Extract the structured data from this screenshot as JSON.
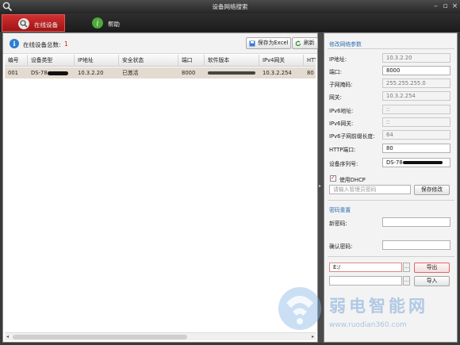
{
  "window": {
    "title": "设备网络搜索"
  },
  "tabs": [
    {
      "label": "在线设备",
      "active": true
    },
    {
      "label": "帮助",
      "active": false
    }
  ],
  "toolbar": {
    "count_label": "在线设备总数:",
    "count_value": "1",
    "save_excel_label": "保存为Excel",
    "refresh_label": "刷新"
  },
  "table": {
    "columns": [
      "编号",
      "设备类型",
      "IP地址",
      "安全状态",
      "端口",
      "软件版本",
      "IPv4网关",
      "HTT"
    ],
    "rows": [
      {
        "no": "001",
        "type": "DS-78",
        "ip": "10.3.2.20",
        "status": "已激活",
        "port": "8000",
        "version": "",
        "gateway": "10.3.2.254",
        "http": "80"
      }
    ]
  },
  "right_panel": {
    "modify_title": "修改网络参数",
    "fields": [
      {
        "label": "IP地址:",
        "value": "10.3.2.20",
        "editable": false
      },
      {
        "label": "端口:",
        "value": "8000",
        "editable": true
      },
      {
        "label": "子网掩码:",
        "value": "255.255.255.0",
        "editable": false
      },
      {
        "label": "网关:",
        "value": "10.3.2.254",
        "editable": false
      },
      {
        "label": "IPv6地址:",
        "value": "::",
        "editable": false
      },
      {
        "label": "IPv6网关:",
        "value": "::",
        "editable": false
      },
      {
        "label": "IPv6子网前缀长度:",
        "value": "64",
        "editable": false
      },
      {
        "label": "HTTP端口:",
        "value": "80",
        "editable": true
      },
      {
        "label": "设备序列号:",
        "value": "DS-78",
        "editable": true
      }
    ],
    "dhcp_label": "使用DHCP",
    "password_placeholder": "请输入管理员密码",
    "save_modify_label": "保存修改",
    "reset_title": "密码重置",
    "new_password_label": "新密码:",
    "confirm_password_label": "确认密码:",
    "export_path": "E:/",
    "dots_label": "...",
    "export_label": "导出",
    "import_label": "导入"
  },
  "watermark": {
    "text": "弱电智能网",
    "url": "www.ruodian360.com"
  },
  "colors": {
    "accent_red": "#b51a1a",
    "title_blue": "#2f6fb0",
    "count_red": "#dd1111",
    "selected_row": "#e4dbd0"
  }
}
